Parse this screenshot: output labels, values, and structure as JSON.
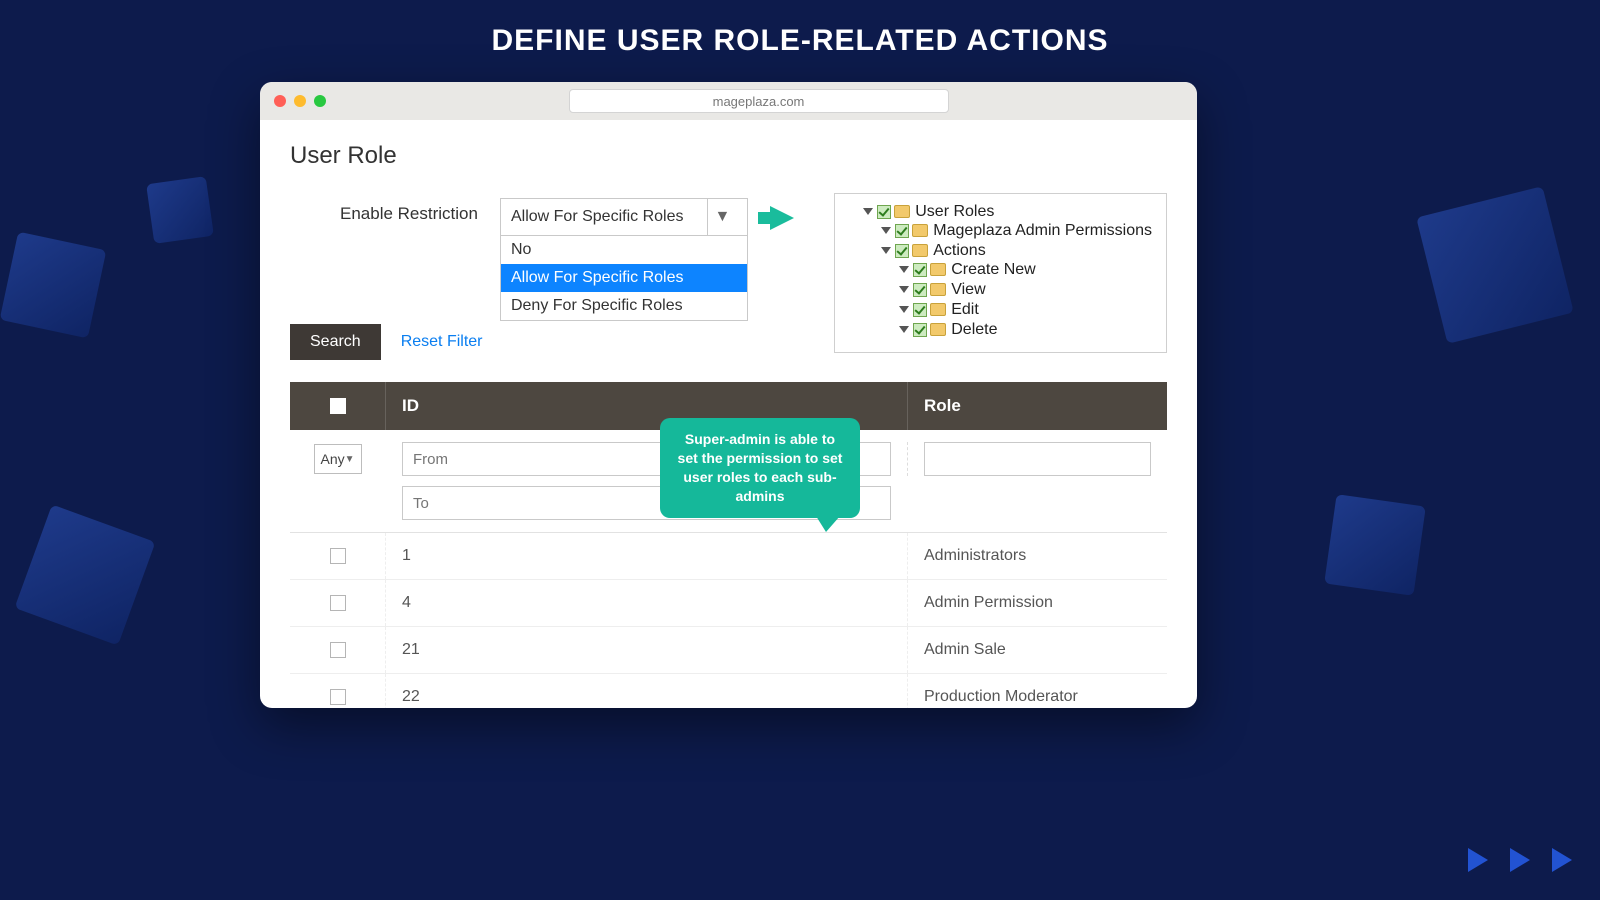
{
  "hero": {
    "title": "DEFINE USER ROLE-RELATED ACTIONS"
  },
  "browser": {
    "address": "mageplaza.com"
  },
  "page": {
    "title": "User Role"
  },
  "restrict": {
    "label": "Enable Restriction",
    "selected": "Allow For Specific Roles",
    "options": [
      "No",
      "Allow For Specific Roles",
      "Deny For Specific Roles"
    ]
  },
  "tree": {
    "root": "User Roles",
    "level2": "Mageplaza Admin Permissions",
    "level2b": "Actions",
    "actions": [
      "Create New",
      "View",
      "Edit",
      "Delete"
    ]
  },
  "actions": {
    "search": "Search",
    "reset": "Reset Filter"
  },
  "table": {
    "headers": {
      "id": "ID",
      "role": "Role"
    },
    "filters": {
      "any": "Any",
      "from": "From",
      "to": "To"
    },
    "rows": [
      {
        "id": "1",
        "role": "Administrators"
      },
      {
        "id": "4",
        "role": "Admin Permission"
      },
      {
        "id": "21",
        "role": "Admin Sale"
      },
      {
        "id": "22",
        "role": "Production Moderator"
      }
    ]
  },
  "tooltip": "Super-admin is able to set the permission to set user roles to each sub-admins"
}
